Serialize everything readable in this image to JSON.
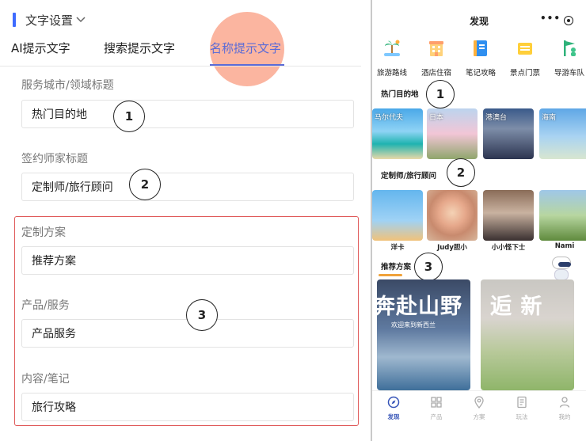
{
  "settings": {
    "section_title": "文字设置",
    "tabs": [
      "AI提示文字",
      "搜索提示文字",
      "名称提示文字"
    ],
    "active_tab": 2,
    "fields": [
      {
        "label": "服务城市/领域标题",
        "value": "热门目的地"
      },
      {
        "label": "签约师家标题",
        "value": "定制师/旅行顾问"
      },
      {
        "label": "定制方案",
        "value": "推荐方案"
      },
      {
        "label": "产品/服务",
        "value": "产品服务"
      },
      {
        "label": "内容/笔记",
        "value": "旅行攻略"
      }
    ]
  },
  "callouts": [
    "1",
    "2",
    "3"
  ],
  "preview": {
    "title": "发现",
    "menu_glyph": "•••",
    "categories": [
      {
        "label": "旅游路线",
        "icon": "palm-tree-icon",
        "color": "#2fb27a"
      },
      {
        "label": "酒店住宿",
        "icon": "hotel-icon",
        "color": "#ffb13b"
      },
      {
        "label": "笔记攻略",
        "icon": "notebook-icon",
        "color": "#2f8ff0"
      },
      {
        "label": "景点门票",
        "icon": "ticket-icon",
        "color": "#f5b400"
      },
      {
        "label": "导游车队",
        "icon": "guide-flag-icon",
        "color": "#2fb27a"
      }
    ],
    "section_hot": "热门目的地",
    "destinations": [
      "马尔代夫",
      "日本",
      "港澳台",
      "海南"
    ],
    "section_advisors": "定制师/旅行顾问",
    "advisors": [
      "洋卡",
      "Judy胆小",
      "小小怪下士",
      "Nami"
    ],
    "section_plans": "推荐方案",
    "plan_cards": [
      {
        "big": "奔赴山野",
        "sub": "欢迎来到新西兰"
      },
      {
        "big": "逅  新",
        "sub": ""
      }
    ],
    "nav": [
      {
        "label": "发现",
        "icon": "compass-icon",
        "active": true
      },
      {
        "label": "产品",
        "icon": "grid-icon",
        "active": false
      },
      {
        "label": "方案",
        "icon": "location-pin-icon",
        "active": false
      },
      {
        "label": "玩法",
        "icon": "document-icon",
        "active": false
      },
      {
        "label": "我的",
        "icon": "user-icon",
        "active": false
      }
    ]
  }
}
